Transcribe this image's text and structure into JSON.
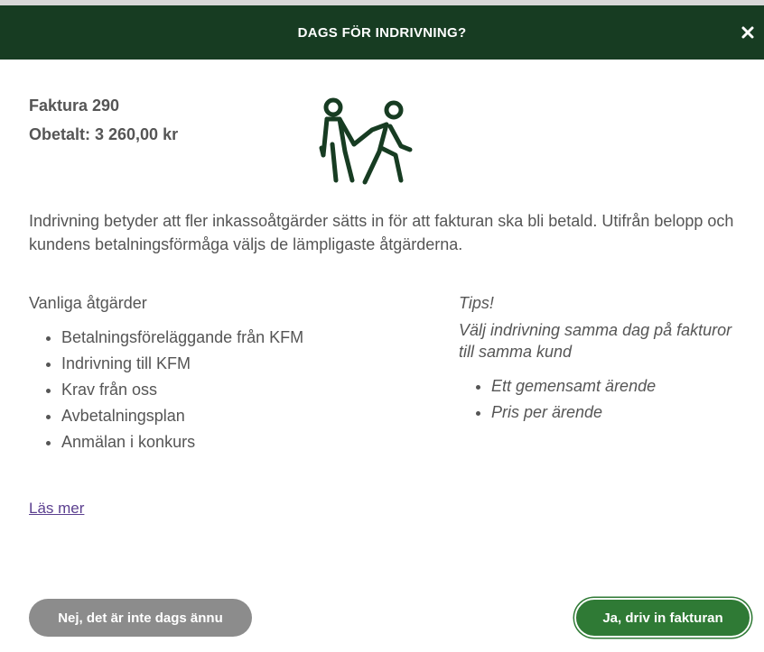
{
  "modal": {
    "title": "DAGS FÖR INDRIVNING?",
    "close_icon": "close-icon"
  },
  "invoice": {
    "number_label": "Faktura 290",
    "unpaid_label": "Obetalt: 3 260,00 kr"
  },
  "illustration_icon": "two-walking-people-icon",
  "description": "Indrivning betyder att fler inkassoåtgärder sätts in för att fakturan ska bli betald. Utifrån belopp och kundens betalningsförmåga väljs de lämpligaste åtgärderna.",
  "common_actions": {
    "heading": "Vanliga åtgärder",
    "items": [
      "Betalningsföreläggande från KFM",
      "Indrivning till KFM",
      "Krav från oss",
      "Avbetalningsplan",
      "Anmälan i konkurs"
    ]
  },
  "tips": {
    "heading": "Tips!",
    "text": "Välj indrivning samma dag på fakturor till samma kund",
    "items": [
      "Ett gemensamt ärende",
      "Pris per ärende"
    ]
  },
  "read_more_label": "Läs mer",
  "buttons": {
    "no_label": "Nej, det är inte dags ännu",
    "yes_label": "Ja, driv in fakturan"
  },
  "colors": {
    "header_bg": "#173c22",
    "primary_button": "#2f7a35",
    "secondary_button": "#8c8c8c",
    "text": "#555555",
    "link": "#5b3f8f"
  }
}
